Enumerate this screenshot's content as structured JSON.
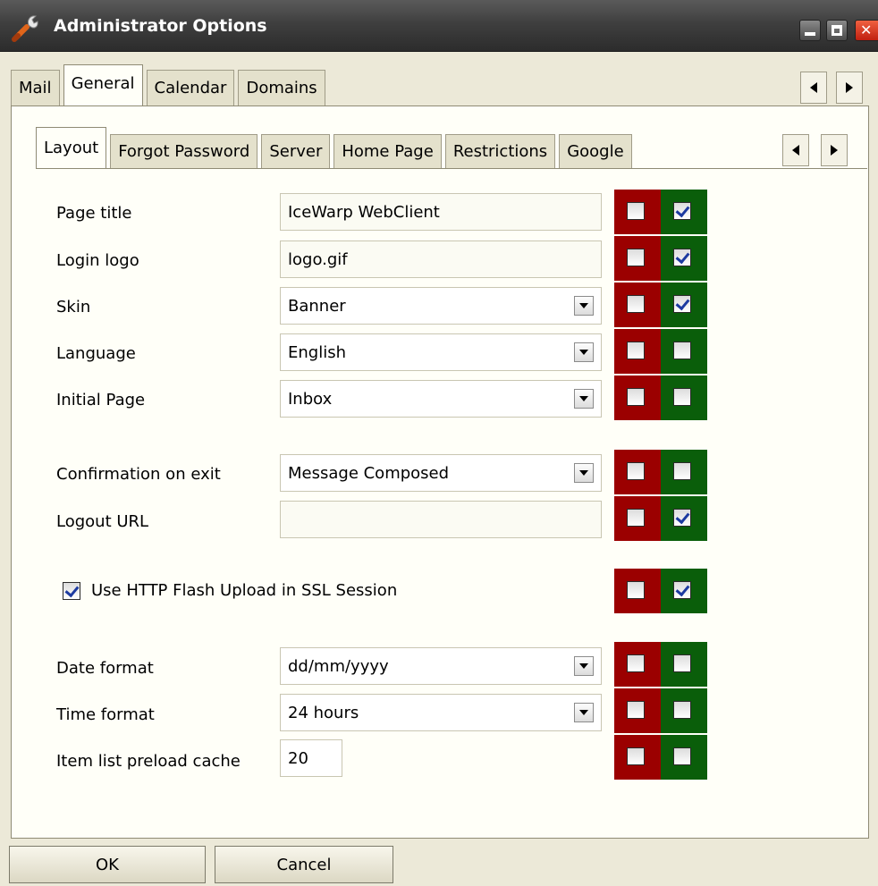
{
  "window": {
    "title": "Administrator Options",
    "buttons": [
      "minimize",
      "maximize",
      "close"
    ]
  },
  "outer_tabs": [
    {
      "label": "Mail",
      "active": false
    },
    {
      "label": "General",
      "active": true
    },
    {
      "label": "Calendar",
      "active": false
    },
    {
      "label": "Domains",
      "active": false
    }
  ],
  "inner_tabs": [
    {
      "label": "Layout",
      "active": true
    },
    {
      "label": "Forgot Password",
      "active": false
    },
    {
      "label": "Server",
      "active": false
    },
    {
      "label": "Home Page",
      "active": false
    },
    {
      "label": "Restrictions",
      "active": false
    },
    {
      "label": "Google",
      "active": false
    }
  ],
  "fields": {
    "page_title": {
      "label": "Page title",
      "value": "IceWarp WebClient",
      "red_checked": false,
      "green_checked": true
    },
    "login_logo": {
      "label": "Login logo",
      "value": "logo.gif",
      "red_checked": false,
      "green_checked": true
    },
    "skin": {
      "label": "Skin",
      "value": "Banner",
      "red_checked": false,
      "green_checked": true
    },
    "language": {
      "label": "Language",
      "value": "English",
      "red_checked": false,
      "green_checked": false
    },
    "initial_page": {
      "label": "Initial Page",
      "value": "Inbox",
      "red_checked": false,
      "green_checked": false
    },
    "confirmation_on_exit": {
      "label": "Confirmation on exit",
      "value": "Message Composed",
      "red_checked": false,
      "green_checked": false
    },
    "logout_url": {
      "label": "Logout URL",
      "value": "",
      "red_checked": false,
      "green_checked": true
    },
    "flash_upload": {
      "label": "Use HTTP Flash Upload in SSL Session",
      "checked": true,
      "red_checked": false,
      "green_checked": true
    },
    "date_format": {
      "label": "Date format",
      "value": "dd/mm/yyyy",
      "red_checked": false,
      "green_checked": false
    },
    "time_format": {
      "label": "Time format",
      "value": "24 hours",
      "red_checked": false,
      "green_checked": false
    },
    "preload_cache": {
      "label": "Item list preload cache",
      "value": "20",
      "red_checked": false,
      "green_checked": false
    }
  },
  "footer": {
    "ok_label": "OK",
    "cancel_label": "Cancel"
  },
  "colors": {
    "deny_flag": "#9b0000",
    "allow_flag": "#0a5e0a",
    "title_bar": "#3f3f3f"
  }
}
